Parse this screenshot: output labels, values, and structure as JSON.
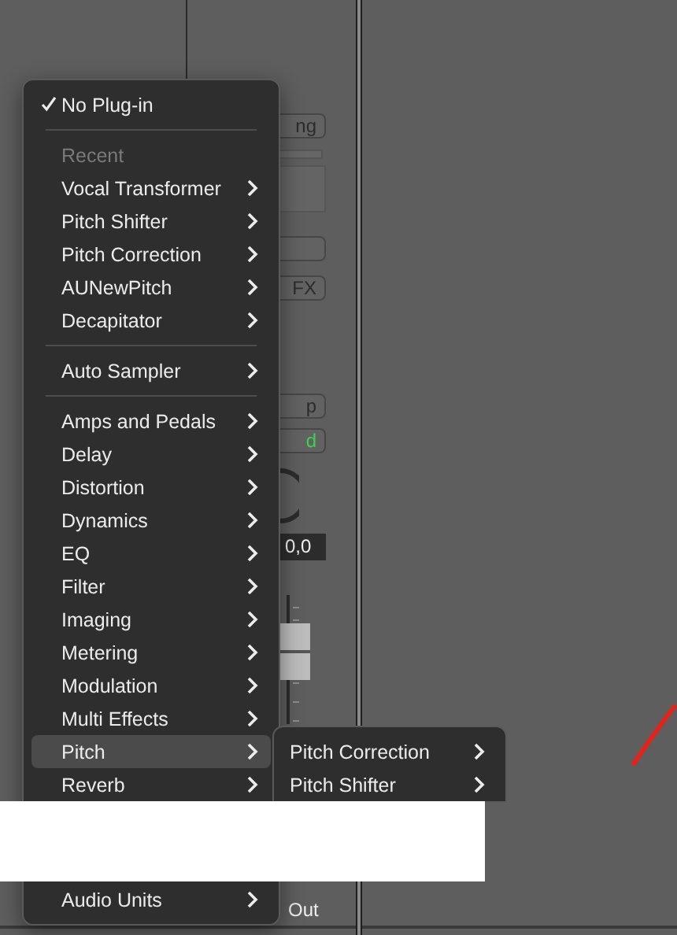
{
  "channel_strip": {
    "controls": [
      {
        "kind": "button",
        "label": "ng",
        "active": false
      },
      {
        "kind": "meter"
      },
      {
        "kind": "slot"
      },
      {
        "kind": "button"
      },
      {
        "kind": "button",
        "label": "FX",
        "active": false
      },
      {
        "kind": "button",
        "label": "p",
        "active": false
      },
      {
        "kind": "button",
        "label": "d",
        "active": true
      },
      {
        "kind": "knob"
      },
      {
        "kind": "readout",
        "label": "0,0"
      },
      {
        "kind": "fader"
      },
      {
        "kind": "label",
        "label": "Out"
      }
    ]
  },
  "plugin_menu": {
    "items": [
      {
        "kind": "item",
        "label": "No Plug-in",
        "checked": true,
        "selected": false,
        "submenu": false
      },
      {
        "kind": "separator"
      },
      {
        "kind": "header",
        "label": "Recent"
      },
      {
        "kind": "item",
        "label": "Vocal Transformer",
        "checked": false,
        "selected": false,
        "submenu": true
      },
      {
        "kind": "item",
        "label": "Pitch Shifter",
        "checked": false,
        "selected": false,
        "submenu": true
      },
      {
        "kind": "item",
        "label": "Pitch Correction",
        "checked": false,
        "selected": false,
        "submenu": true
      },
      {
        "kind": "item",
        "label": "AUNewPitch",
        "checked": false,
        "selected": false,
        "submenu": true
      },
      {
        "kind": "item",
        "label": "Decapitator",
        "checked": false,
        "selected": false,
        "submenu": true
      },
      {
        "kind": "separator"
      },
      {
        "kind": "item",
        "label": "Auto Sampler",
        "checked": false,
        "selected": false,
        "submenu": true
      },
      {
        "kind": "separator"
      },
      {
        "kind": "item",
        "label": "Amps and Pedals",
        "checked": false,
        "selected": false,
        "submenu": true
      },
      {
        "kind": "item",
        "label": "Delay",
        "checked": false,
        "selected": false,
        "submenu": true
      },
      {
        "kind": "item",
        "label": "Distortion",
        "checked": false,
        "selected": false,
        "submenu": true
      },
      {
        "kind": "item",
        "label": "Dynamics",
        "checked": false,
        "selected": false,
        "submenu": true
      },
      {
        "kind": "item",
        "label": "EQ",
        "checked": false,
        "selected": false,
        "submenu": true
      },
      {
        "kind": "item",
        "label": "Filter",
        "checked": false,
        "selected": false,
        "submenu": true
      },
      {
        "kind": "item",
        "label": "Imaging",
        "checked": false,
        "selected": false,
        "submenu": true
      },
      {
        "kind": "item",
        "label": "Metering",
        "checked": false,
        "selected": false,
        "submenu": true
      },
      {
        "kind": "item",
        "label": "Modulation",
        "checked": false,
        "selected": false,
        "submenu": true
      },
      {
        "kind": "item",
        "label": "Multi Effects",
        "checked": false,
        "selected": false,
        "submenu": true
      },
      {
        "kind": "item",
        "label": "Pitch",
        "checked": false,
        "selected": true,
        "submenu": true
      },
      {
        "kind": "item",
        "label": "Reverb",
        "checked": false,
        "selected": false,
        "submenu": true
      },
      {
        "kind": "gap"
      },
      {
        "kind": "item",
        "label": "Audio Units",
        "checked": false,
        "selected": false,
        "submenu": true
      }
    ]
  },
  "pitch_submenu": {
    "items": [
      {
        "label": "Pitch Correction",
        "submenu": true
      },
      {
        "label": "Pitch Shifter",
        "submenu": true
      }
    ]
  }
}
